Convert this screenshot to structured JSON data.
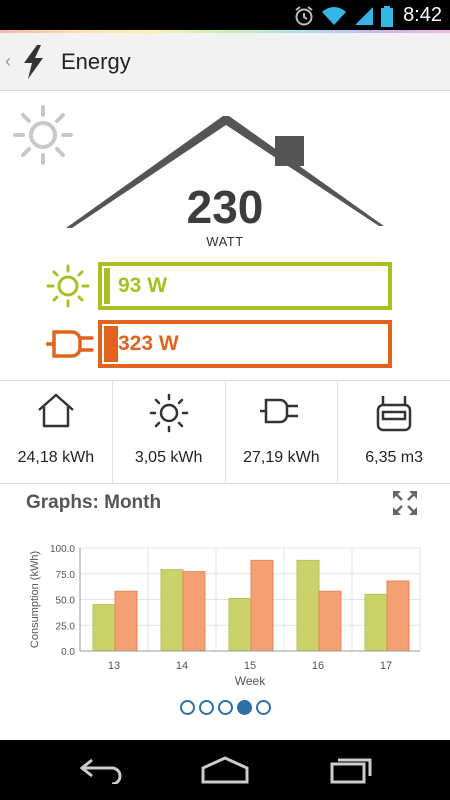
{
  "status_bar": {
    "time": "8:42"
  },
  "action_bar": {
    "title": "Energy"
  },
  "hero": {
    "value": "230",
    "unit": "WATT"
  },
  "solar_bar": {
    "label": "93 W",
    "fill_fraction": 0.02,
    "color": "#a8bf1f"
  },
  "grid_bar": {
    "label": "323 W",
    "fill_fraction": 0.05,
    "color": "#e2631d"
  },
  "stats": [
    {
      "icon": "house-icon",
      "value": "24,18 kWh"
    },
    {
      "icon": "sun-icon",
      "value": "3,05 kWh"
    },
    {
      "icon": "plug-icon",
      "value": "27,19 kWh"
    },
    {
      "icon": "gas-meter-icon",
      "value": "6,35 m3"
    }
  ],
  "graphs": {
    "title": "Graphs: Month"
  },
  "chart_data": {
    "type": "bar",
    "categories": [
      "13",
      "14",
      "15",
      "16",
      "17"
    ],
    "series": [
      {
        "values": [
          45,
          79,
          51,
          88,
          55
        ],
        "color": "#c9d36a"
      },
      {
        "values": [
          58,
          77,
          88,
          58,
          68
        ],
        "color": "#f4a072"
      }
    ],
    "xlabel": "Week",
    "ylabel": "Consumption (kWh)",
    "ylim": [
      0,
      100
    ],
    "yticks": [
      "0.0",
      "25.0",
      "50.0",
      "75.0",
      "100.0"
    ],
    "grid": true
  },
  "pager": {
    "count": 5,
    "active": 3
  },
  "colors": {
    "solar": "#a8bf1f",
    "grid": "#e2631d",
    "house": "#555555",
    "pager": "#2f6fa8"
  }
}
